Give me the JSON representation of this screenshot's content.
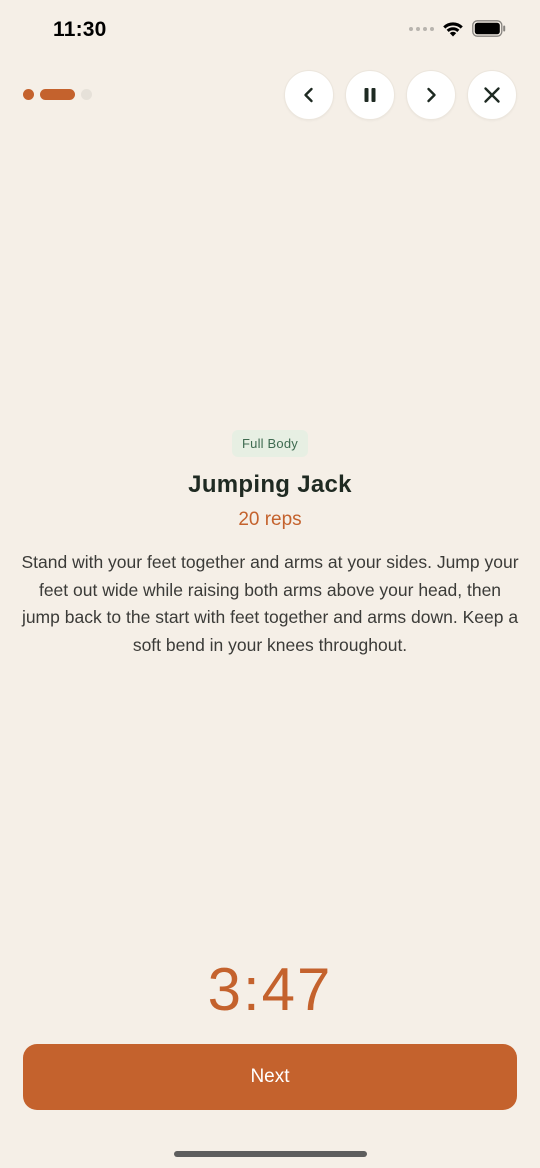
{
  "status_bar": {
    "time": "11:30"
  },
  "progress": {
    "steps": [
      "done",
      "active",
      "todo"
    ]
  },
  "controls": {
    "previous_icon": "chevron-left-icon",
    "pause_icon": "pause-icon",
    "next_icon": "chevron-right-icon",
    "close_icon": "close-icon"
  },
  "exercise": {
    "category": "Full Body",
    "name": "Jumping Jack",
    "reps": "20 reps",
    "description": "Stand with your feet together and arms at your sides. Jump your feet out wide while raising both arms above your head, then jump back to the start with feet together and arms down. Keep a soft bend in your knees throughout."
  },
  "timer": {
    "display": "3:47"
  },
  "actions": {
    "next_label": "Next"
  },
  "colors": {
    "background": "#F5EFE7",
    "accent": "#C4622D",
    "tag_bg": "#E7EFE3",
    "tag_text": "#3F6B50",
    "title": "#1F2A22"
  }
}
